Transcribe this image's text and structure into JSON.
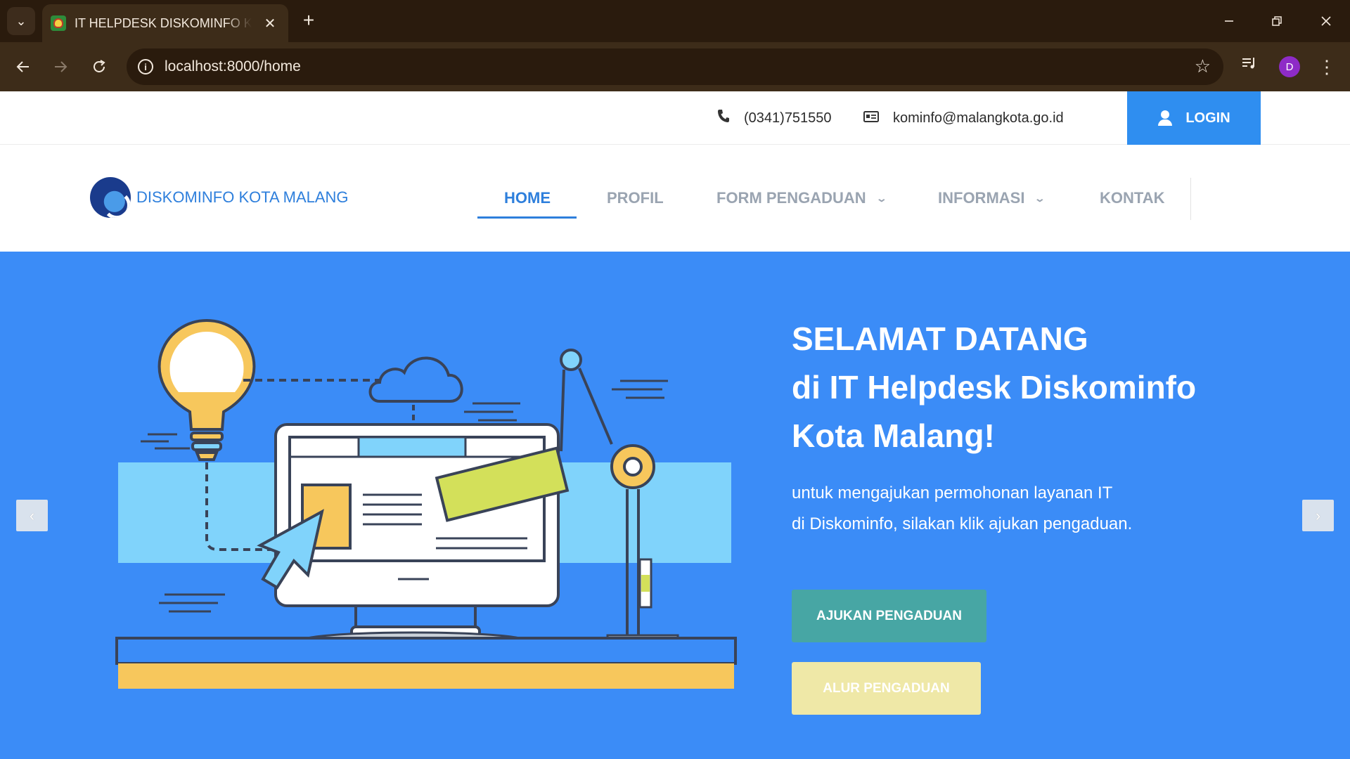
{
  "browser": {
    "tab_title": "IT HELPDESK DISKOMINFO KOTA MALANG",
    "tab_close": "✕",
    "new_tab": "+",
    "url": "localhost:8000/home",
    "profile_initial": "D",
    "window_controls": [
      "minimize-icon",
      "restore-icon",
      "close-icon"
    ]
  },
  "topbar": {
    "phone": "(0341)751550",
    "email": "kominfo@malangkota.go.id",
    "login_label": "LOGIN"
  },
  "header": {
    "logo_text": "DISKOMINFO KOTA MALANG",
    "nav": [
      {
        "label": "HOME",
        "active": true
      },
      {
        "label": "PROFIL",
        "active": false
      },
      {
        "label": "FORM PENGADUAN",
        "active": false,
        "dropdown": true
      },
      {
        "label": "INFORMASI",
        "active": false,
        "dropdown": true
      },
      {
        "label": "KONTAK",
        "active": false
      }
    ]
  },
  "hero": {
    "title_lines": [
      "SELAMAT DATANG",
      "di IT Helpdesk Diskominfo",
      "Kota Malang!"
    ],
    "subtitle_lines": [
      "untuk mengajukan permohonan layanan IT",
      "di Diskominfo, silakan klik ajukan pengaduan."
    ],
    "primary_button": "AJUKAN PENGADUAN",
    "secondary_button": "ALUR PENGADUAN",
    "prev_arrow": "‹",
    "next_arrow": "›"
  },
  "colors": {
    "brand_blue": "#2e7fdc",
    "hero_bg": "#3b8cf7",
    "login_bg": "#2f8ef0",
    "primary_btn": "#47a6a4",
    "secondary_btn": "#efe8a7",
    "chrome_dark": "#2a1b0d",
    "chrome_toolbar": "#3d2c19"
  }
}
